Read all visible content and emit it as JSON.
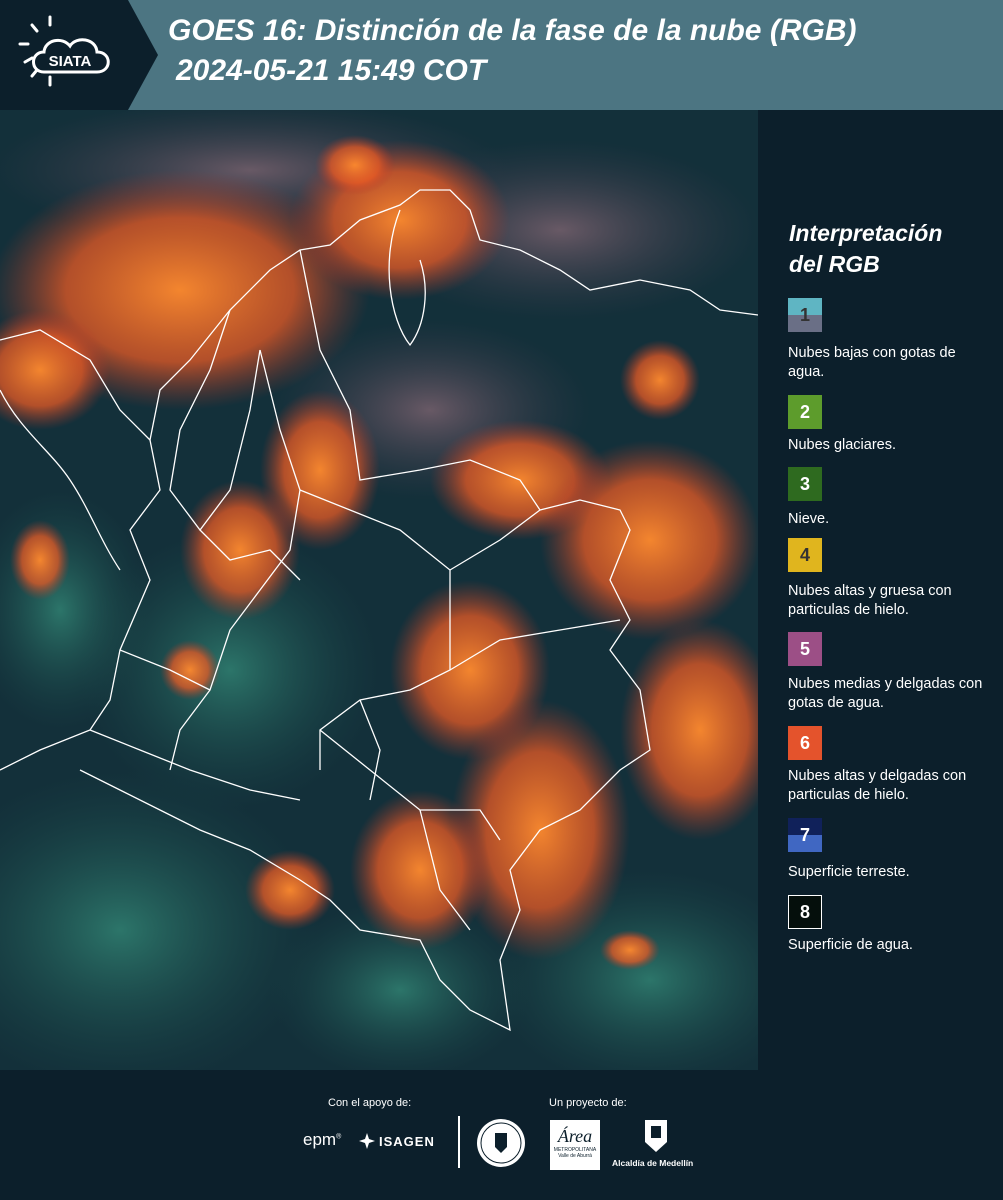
{
  "header": {
    "logo_text": "SIATA",
    "title_line1": "GOES 16: Distinción de la fase de la nube (RGB)",
    "title_line2": "2024-05-21 15:49 COT",
    "background_color": "#4c7582"
  },
  "legend": {
    "heading_line1": "Interpretación",
    "heading_line2": "del RGB",
    "items": [
      {
        "number": "1",
        "label": "Nubes bajas con gotas de agua.",
        "color_top": "#5fb5c3",
        "color_bottom": "#6a6f86"
      },
      {
        "number": "2",
        "label": "Nubes glaciares.",
        "color_top": "#5d9c2c",
        "color_bottom": "#5d9c2c"
      },
      {
        "number": "3",
        "label": "Nieve.",
        "color_top": "#2e6a1f",
        "color_bottom": "#2e6a1f"
      },
      {
        "number": "4",
        "label": "Nubes altas y gruesa con particulas de hielo.",
        "color_top": "#e0b51e",
        "color_bottom": "#e0b51e"
      },
      {
        "number": "5",
        "label": "Nubes medias y delgadas con gotas de agua.",
        "color_top": "#9c4f86",
        "color_bottom": "#9c4f86"
      },
      {
        "number": "6",
        "label": "Nubes altas y delgadas con particulas de hielo.",
        "color_top": "#e4532c",
        "color_bottom": "#e4532c"
      },
      {
        "number": "7",
        "label": "Superficie terreste.",
        "color_top": "#10215a",
        "color_bottom": "#4067c2"
      },
      {
        "number": "8",
        "label": "Superficie de agua.",
        "color_top": "#050f0c",
        "color_bottom": "#050f0c"
      }
    ]
  },
  "footer": {
    "support_label": "Con el apoyo de:",
    "project_label": "Un proyecto de:",
    "partners": [
      "epm",
      "ISAGEN",
      "METROPOLITANA",
      "Valle de Aburrá",
      "Alcaldía de Medellín"
    ],
    "area_logo_text": "Área"
  }
}
